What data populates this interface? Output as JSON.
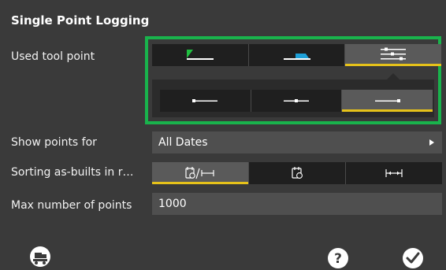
{
  "header": {
    "title": "Single Point Logging"
  },
  "rows": {
    "used_tool_point": "Used tool point",
    "show_points_for": "Show points for",
    "sorting": "Sorting as-builts in r…",
    "max_points": "Max number of points"
  },
  "tool_point": {
    "options": [
      "edge-left-tool-icon",
      "bucket-edge-tool-icon",
      "multi-point-tool-icon"
    ],
    "selected_index": 2
  },
  "tool_point_sub": {
    "options": [
      "point-left-icon",
      "point-center-icon",
      "point-right-icon"
    ],
    "selected_index": 2
  },
  "show_points": {
    "value": "All Dates"
  },
  "sorting": {
    "options": [
      "date-distance-icon",
      "date-icon",
      "distance-icon"
    ],
    "selected_index": 0
  },
  "max_points": {
    "value": "1000"
  },
  "footer": {
    "left_icon": "machine-icon",
    "help_icon": "help-icon",
    "ok_icon": "confirm-icon"
  },
  "colors": {
    "accent": "#e6c21a",
    "highlight": "#19b34c",
    "bucket": "#1ea0d8",
    "edge": "#20c040"
  }
}
